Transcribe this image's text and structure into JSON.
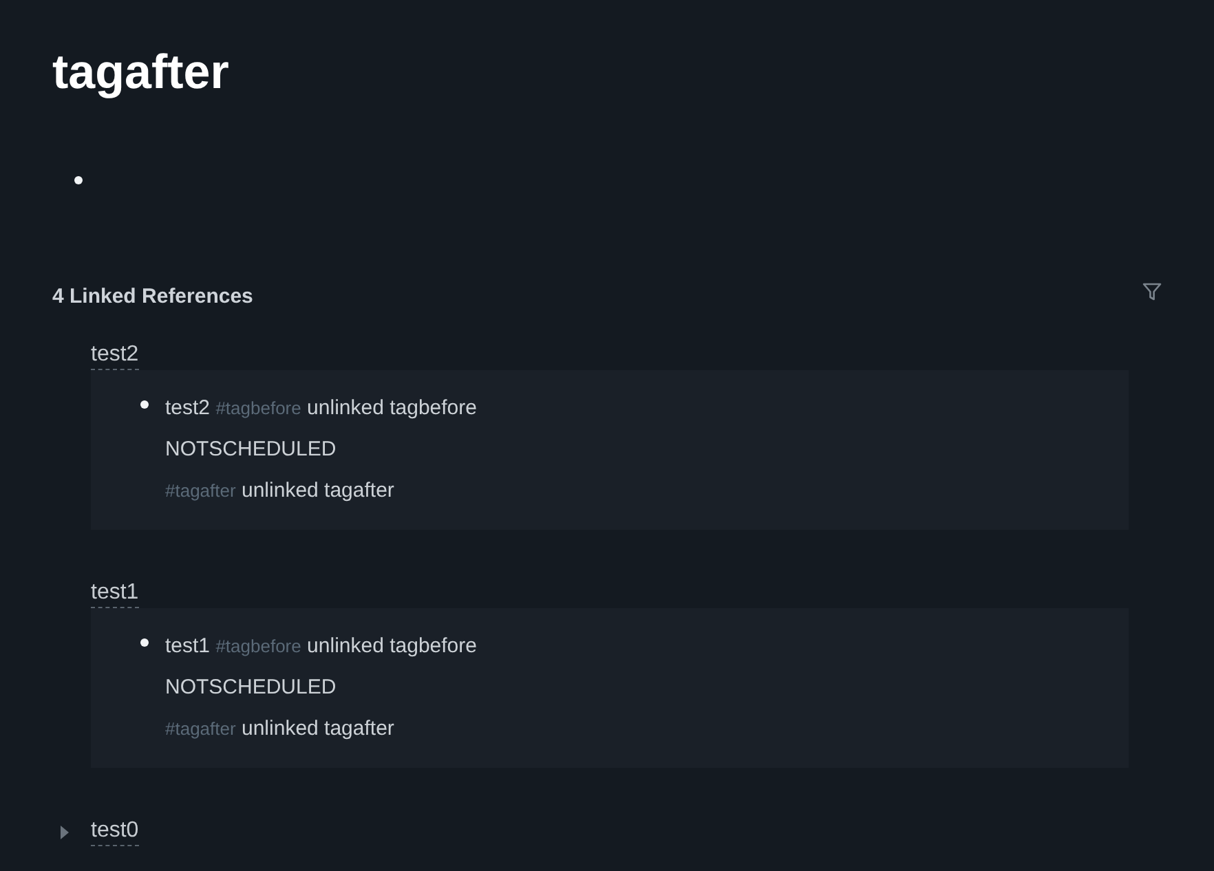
{
  "page": {
    "title": "tagafter",
    "blocks": [
      {
        "kind": "empty"
      }
    ]
  },
  "linked_references": {
    "title": "4 Linked References",
    "groups": [
      {
        "page": "test2",
        "expanded": true,
        "blocks": [
          {
            "lines": [
              {
                "segments": [
                  {
                    "kind": "text",
                    "text": "test2"
                  },
                  {
                    "kind": "tag",
                    "text": "#tagbefore"
                  },
                  {
                    "kind": "text",
                    "text": "unlinked tagbefore"
                  }
                ]
              },
              {
                "segments": [
                  {
                    "kind": "text",
                    "text": "NOTSCHEDULED"
                  }
                ]
              },
              {
                "segments": [
                  {
                    "kind": "tag",
                    "text": "#tagafter"
                  },
                  {
                    "kind": "text",
                    "text": "unlinked tagafter"
                  }
                ]
              }
            ]
          }
        ]
      },
      {
        "page": "test1",
        "expanded": true,
        "blocks": [
          {
            "lines": [
              {
                "segments": [
                  {
                    "kind": "text",
                    "text": "test1"
                  },
                  {
                    "kind": "tag",
                    "text": "#tagbefore"
                  },
                  {
                    "kind": "text",
                    "text": "unlinked tagbefore"
                  }
                ]
              },
              {
                "segments": [
                  {
                    "kind": "text",
                    "text": "NOTSCHEDULED"
                  }
                ]
              },
              {
                "segments": [
                  {
                    "kind": "tag",
                    "text": "#tagafter"
                  },
                  {
                    "kind": "text",
                    "text": "unlinked tagafter"
                  }
                ]
              }
            ]
          }
        ]
      },
      {
        "page": "test0",
        "expanded": false
      }
    ]
  }
}
